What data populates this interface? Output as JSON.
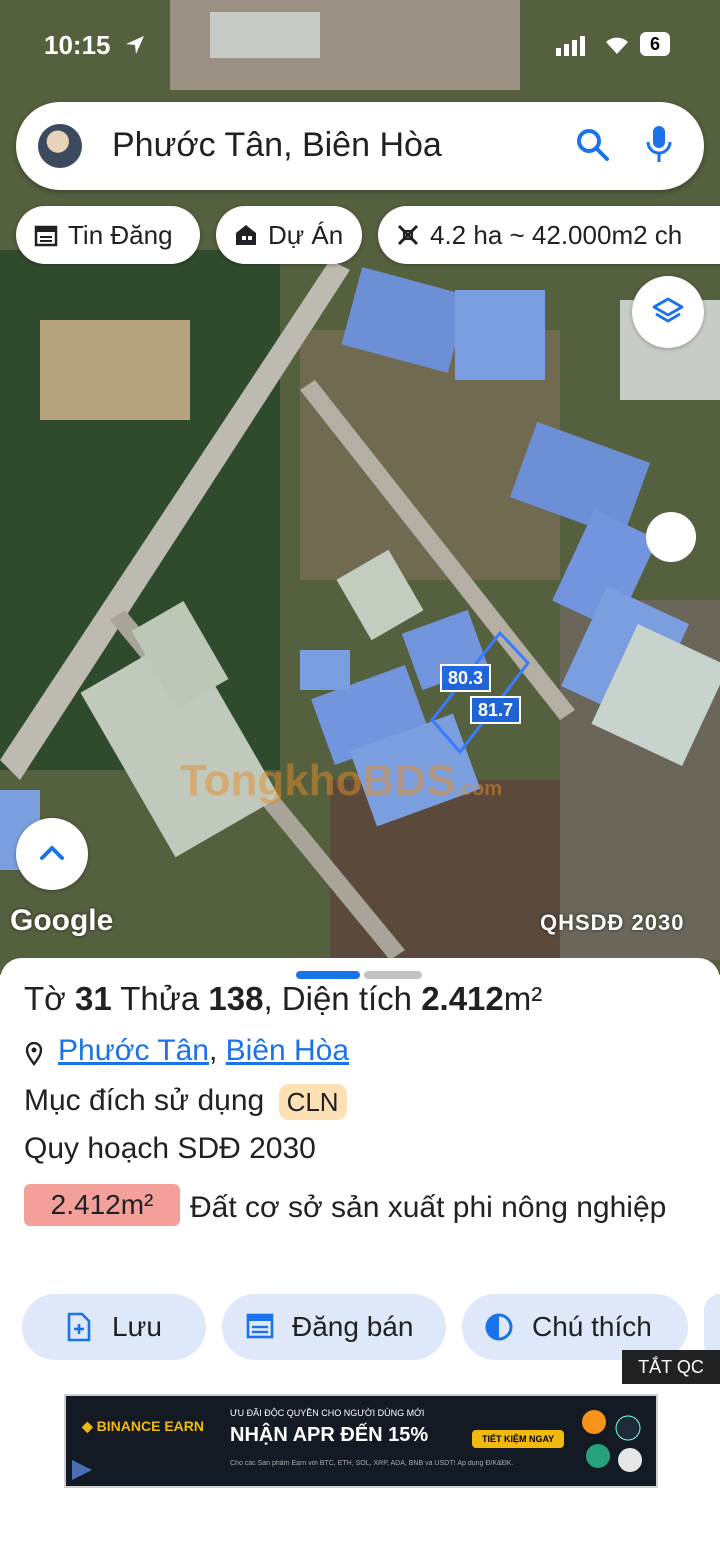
{
  "status": {
    "time": "10:15",
    "battery": "6"
  },
  "search": {
    "query": "Phước Tân, Biên Hòa"
  },
  "chips": [
    {
      "label": "Tin Đăng",
      "icon": "calendar-icon"
    },
    {
      "label": "Dự Án",
      "icon": "building-icon"
    },
    {
      "label": "4.2 ha ~ 42.000m2 ch",
      "icon": "ruler-icon"
    }
  ],
  "map": {
    "attribution": "Google",
    "layer_label": "QHSDĐ 2030",
    "watermark": "TongkhoBDS",
    "watermark_sub": ".com",
    "measure_1": "80.3",
    "measure_2": "81.7"
  },
  "sheet": {
    "title_prefix": "Tờ ",
    "sheet_no": "31",
    "title_mid": " Thửa ",
    "parcel_no": "138",
    "title_area_label": ", Diện tích ",
    "title_area": "2.412",
    "title_unit": "m²",
    "ward": "Phước Tân",
    "addr_sep": ",",
    "city": "Biên Hòa",
    "purpose_label": "Mục đích sử dụng",
    "purpose_code": "CLN",
    "plan_label": "Quy hoạch SDĐ 2030",
    "plan_area": "2.412m²",
    "plan_use": "Đất cơ sở sản xuất phi nông nghiệp"
  },
  "actions": {
    "save": "Lưu",
    "post_sale": "Đăng bán",
    "legend": "Chú thích"
  },
  "ad": {
    "close_label": "TẮT QC",
    "brand": "BINANCE EARN",
    "small": "ƯU ĐÃI ĐỘC QUYỀN CHO NGƯỜI DÙNG MỚI",
    "headline": "NHẬN APR ĐẾN 15%",
    "cta": "TIẾT KIỆM NGAY",
    "fine": "Cho các Sản phẩm Earn với BTC, ETH, SOL, XRP, ADA, BNB và USDT! Áp dụng Đ/K&ĐK."
  },
  "colors": {
    "accent": "#1a73e8",
    "area_badge": "#f4a09a",
    "code_badge": "#fde1b4"
  }
}
